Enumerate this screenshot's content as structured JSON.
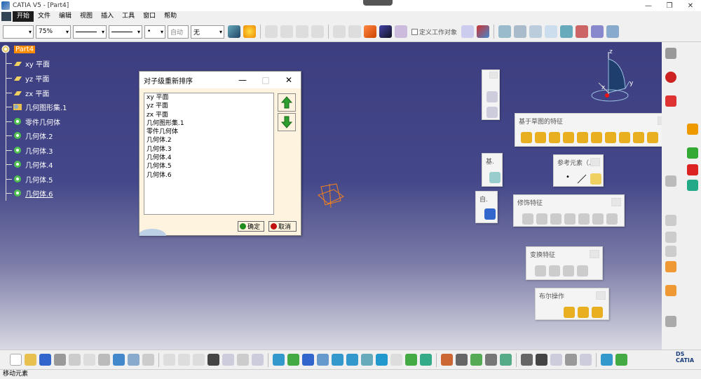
{
  "window": {
    "title": "CATIA V5 - [Part4]",
    "minimize": "—",
    "restore": "❐",
    "close": "✕"
  },
  "menu": [
    "开始",
    "文件",
    "编辑",
    "视图",
    "插入",
    "工具",
    "窗口",
    "帮助"
  ],
  "toolbar": {
    "zoom": "75%",
    "auto": "自动",
    "none": "无",
    "define_work_object": "定义工作对象"
  },
  "tree": {
    "root": "Part4",
    "items": [
      "xy 平面",
      "yz 平面",
      "zx 平面",
      "几何图形集.1",
      "零件几何体",
      "几何体.2",
      "几何体.3",
      "几何体.4",
      "几何体.5",
      "几何体.6"
    ]
  },
  "dialog": {
    "title": "对子级重新排序",
    "items": [
      "xy 平面",
      "yz 平面",
      "zx 平面",
      "几何图形集.1",
      "零件几何体",
      "几何体.2",
      "几何体.3",
      "几何体.4",
      "几何体.5",
      "几何体.6"
    ],
    "ok": "确定",
    "cancel": "取消",
    "minimize": "—",
    "maximize": "□",
    "close": "✕"
  },
  "panels": {
    "sketch_based": "基于草图的特征",
    "reference": "参考元素（...",
    "dress_up": "修饰特征",
    "transform": "变换特征",
    "boolean": "布尔操作",
    "base_short": "基.",
    "auto_short": "自."
  },
  "compass": {
    "x": "x",
    "y": "y",
    "z": "z"
  },
  "status": {
    "text": "移动元素"
  },
  "brand": {
    "logo_text": "DS CATIA"
  },
  "colors": {
    "accent_orange": "#ff8c00",
    "arrow_green": "#2e9e2e",
    "ok_green": "#1e8c1e",
    "cancel_red": "#c01010"
  }
}
